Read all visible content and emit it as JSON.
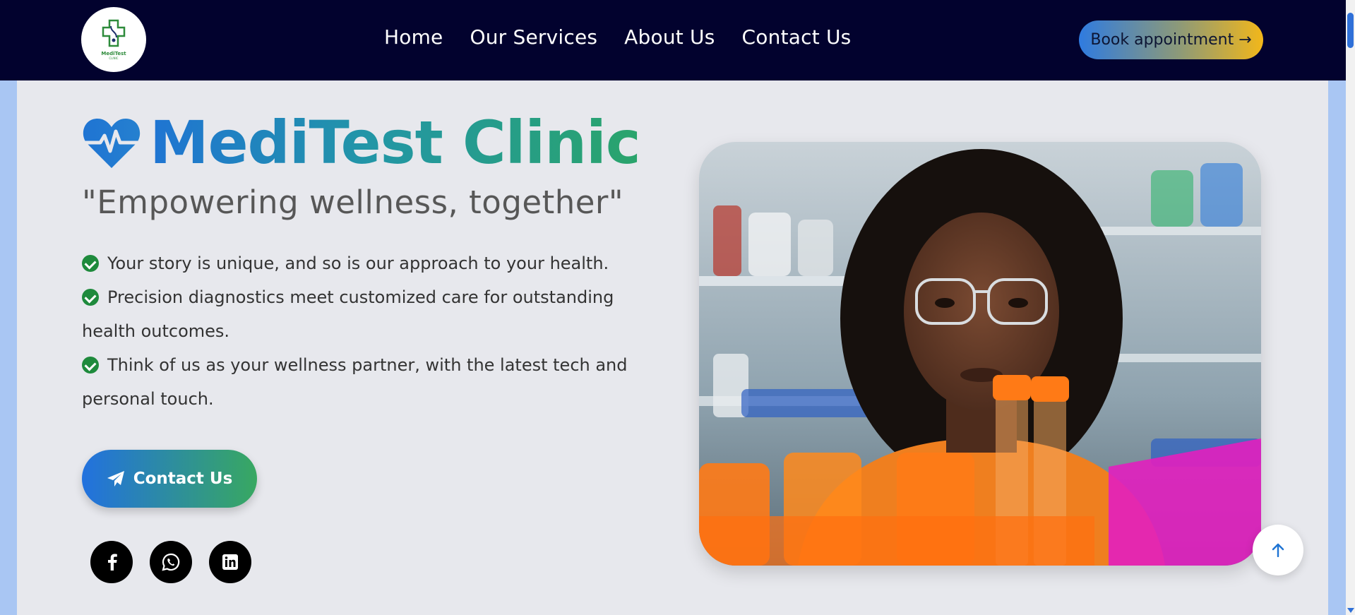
{
  "navbar": {
    "logo": {
      "name": "MediTest",
      "sub": "CLINIC",
      "icon": "medical-cross-icon"
    },
    "links": [
      "Home",
      "Our Services",
      "About Us",
      "Contact Us"
    ],
    "book_label": "Book appointment →"
  },
  "hero": {
    "title": "MediTest Clinic",
    "title_icon": "heartbeat-icon",
    "tagline": "\"Empowering wellness, together\"",
    "features": [
      "Your story is unique, and so is our approach to your health.",
      "Precision diagnostics meet customized care for outstanding health outcomes.",
      "Think of us as your wellness partner, with the latest tech and personal touch."
    ],
    "contact_label": "Contact Us",
    "contact_icon": "paper-plane-icon",
    "socials": [
      "facebook-icon",
      "whatsapp-icon",
      "linkedin-icon"
    ],
    "photo": "lab-technician-photo"
  },
  "scroll_top_icon": "arrow-up-icon",
  "colors": {
    "nav_bg": "#02022e",
    "hero_bg": "#e7e8ed",
    "side_bg": "#a9c6f3",
    "brand_blue": "#1f74d3",
    "brand_green": "#2aa46b",
    "check_green": "#1e8a3c",
    "book_gradient_start": "#2f7be0",
    "book_gradient_end": "#f2b71a"
  }
}
